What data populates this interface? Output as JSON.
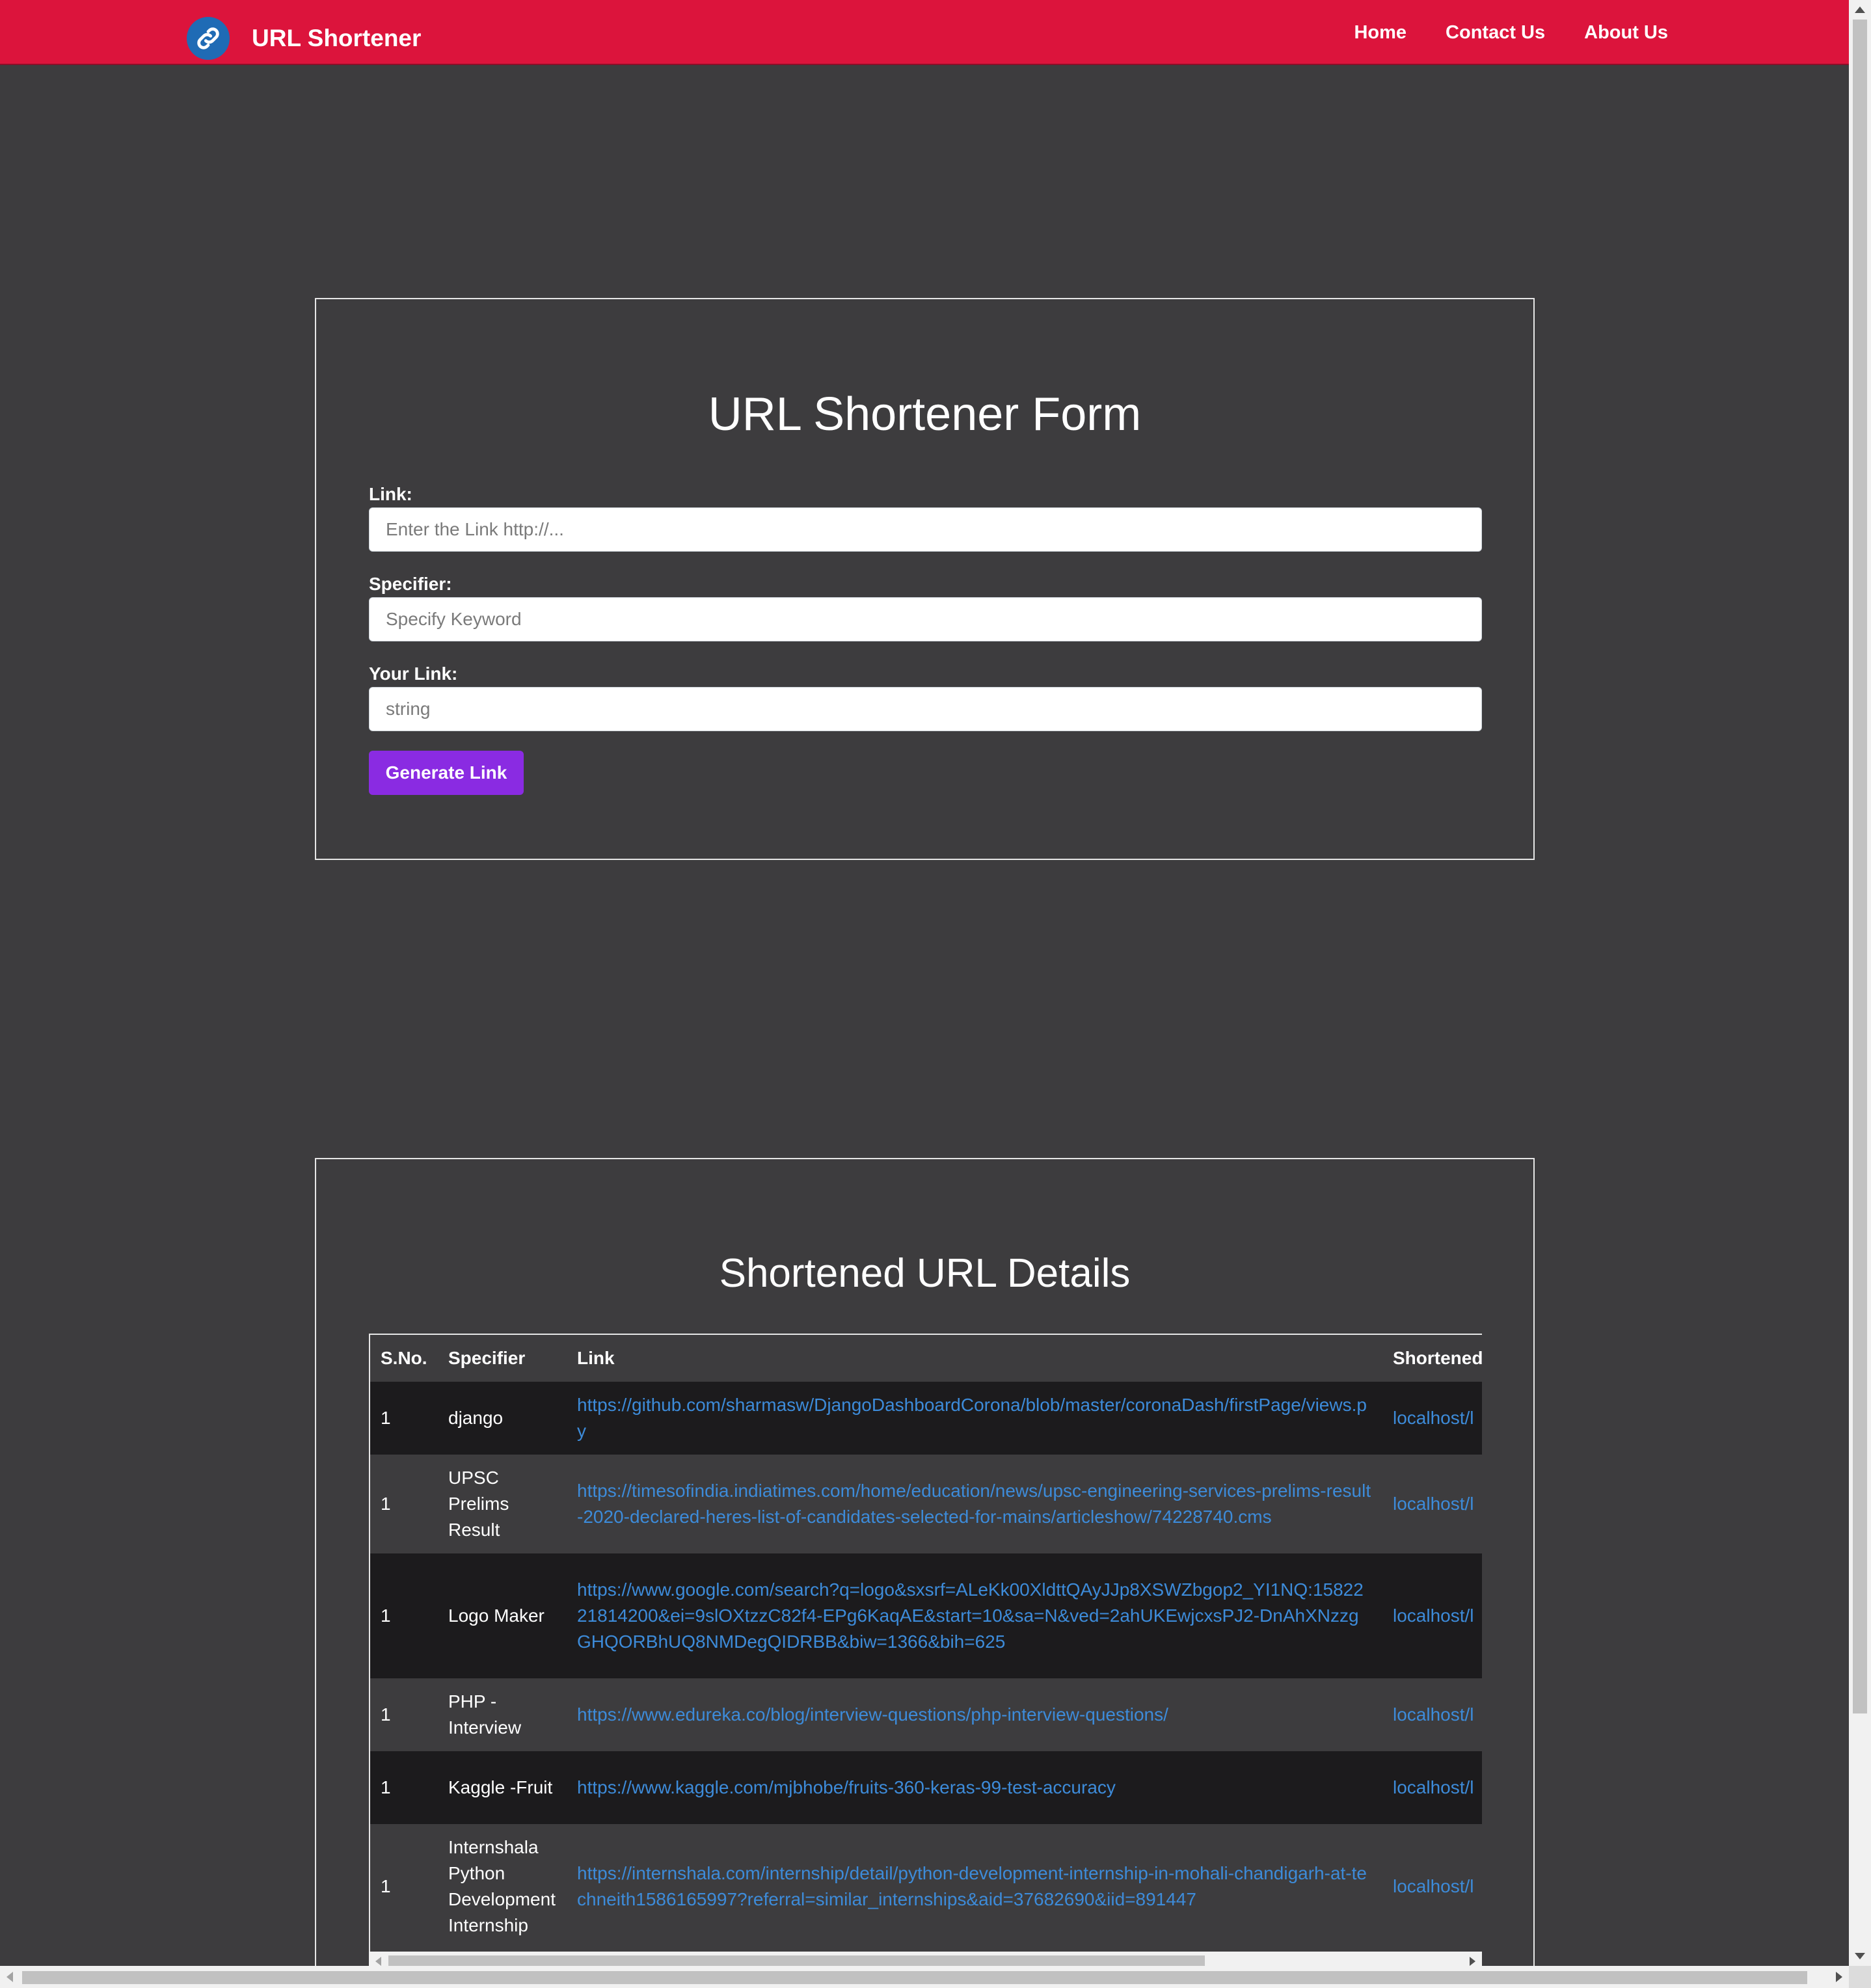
{
  "navbar": {
    "brand": "URL Shortener",
    "logo_icon": "link-icon",
    "links": [
      {
        "label": "Home"
      },
      {
        "label": "Contact Us"
      },
      {
        "label": "About Us"
      }
    ],
    "color": "#dc143c"
  },
  "form": {
    "title": "URL Shortener Form",
    "link_label": "Link:",
    "link_placeholder": "Enter the Link http://...",
    "specifier_label": "Specifier:",
    "specifier_placeholder": "Specify Keyword",
    "your_link_label": "Your Link:",
    "your_link_placeholder": "string",
    "button_label": "Generate Link",
    "button_color": "#8a2be2"
  },
  "table": {
    "title": "Shortened URL Details",
    "headers": [
      "S.No.",
      "Specifier",
      "Link",
      "Shortened"
    ],
    "rows": [
      {
        "sno": "1",
        "specifier": "django",
        "link": "https://github.com/sharmasw/DjangoDashboardCorona/blob/master/coronaDash/firstPage/views.py",
        "short": "localhost/l"
      },
      {
        "sno": "1",
        "specifier": "UPSC Prelims Result",
        "link": "https://timesofindia.indiatimes.com/home/education/news/upsc-engineering-services-prelims-result-2020-declared-heres-list-of-candidates-selected-for-mains/articleshow/74228740.cms",
        "short": "localhost/l"
      },
      {
        "sno": "1",
        "specifier": "Logo Maker",
        "link": "https://www.google.com/search?q=logo&sxsrf=ALeKk00XldttQAyJJp8XSWZbgop2_YI1NQ:1582221814200&ei=9slOXtzzC82f4-EPg6KaqAE&start=10&sa=N&ved=2ahUKEwjcxsPJ2-DnAhXNzzgGHQORBhUQ8NMDegQIDRBB&biw=1366&bih=625",
        "short": "localhost/l"
      },
      {
        "sno": "1",
        "specifier": "PHP - Interview",
        "link": "https://www.edureka.co/blog/interview-questions/php-interview-questions/",
        "short": "localhost/l"
      },
      {
        "sno": "1",
        "specifier": "Kaggle -Fruit",
        "link": "https://www.kaggle.com/mjbhobe/fruits-360-keras-99-test-accuracy",
        "short": "localhost/l"
      },
      {
        "sno": "1",
        "specifier": "Internshala Python Development Internship",
        "link": "https://internshala.com/internship/detail/python-development-internship-in-mohali-chandigarh-at-techneith1586165997?referral=similar_internships&aid=37682690&iid=891447",
        "short": "localhost/l"
      }
    ],
    "link_color": "#3d8bd9"
  }
}
